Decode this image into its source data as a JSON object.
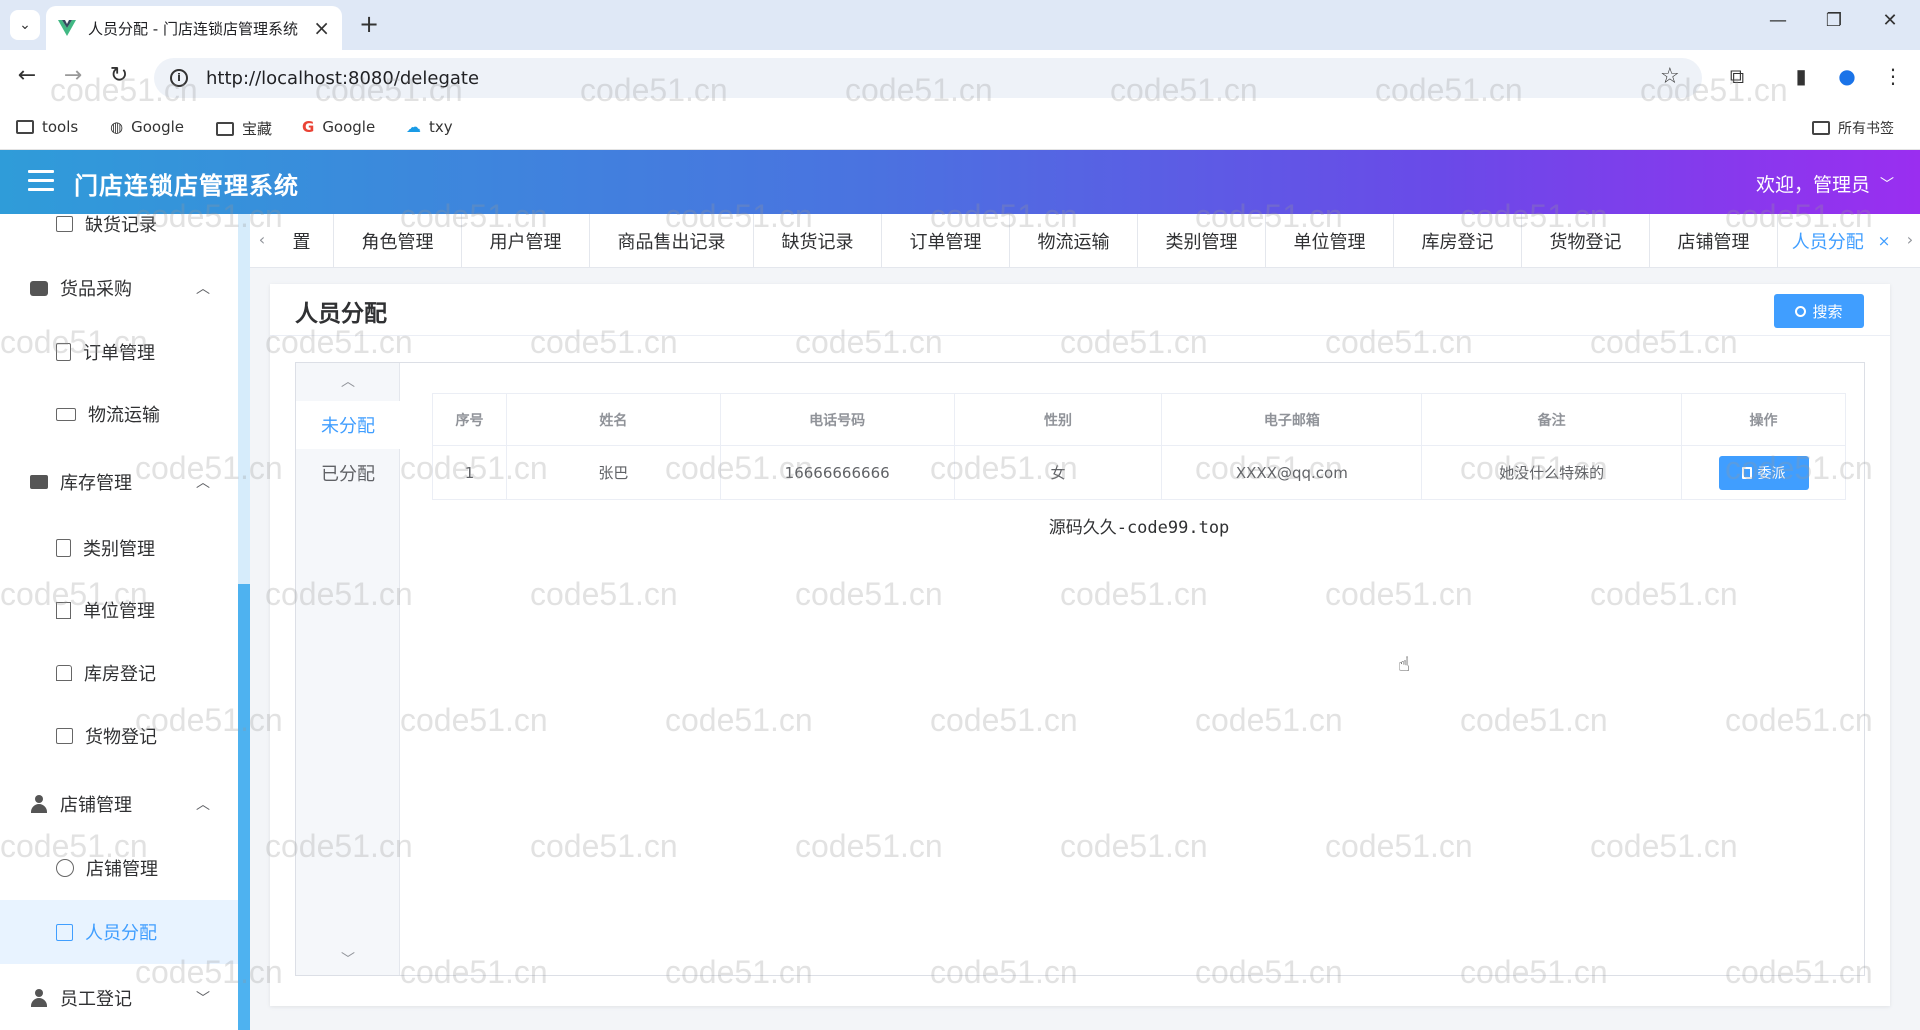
{
  "browser": {
    "tab_title": "人员分配 - 门店连锁店管理系统",
    "url": "http://localhost:8080/delegate",
    "bookmarks": [
      "tools",
      "Google",
      "宝藏",
      "Google",
      "txy"
    ],
    "all_bookmarks": "所有书签"
  },
  "header": {
    "title": "门店连锁店管理系统",
    "welcome": "欢迎，管理员"
  },
  "sidebar": {
    "items": [
      {
        "label": "缺货记录",
        "type": "sub",
        "icon": "stock-icon"
      },
      {
        "label": "货品采购",
        "type": "group",
        "icon": "bag-icon"
      },
      {
        "label": "订单管理",
        "type": "sub",
        "icon": "doc-icon"
      },
      {
        "label": "物流运输",
        "type": "sub",
        "icon": "truck-icon"
      },
      {
        "label": "库存管理",
        "type": "group",
        "icon": "stack-icon"
      },
      {
        "label": "类别管理",
        "type": "sub",
        "icon": "doc-icon"
      },
      {
        "label": "单位管理",
        "type": "sub",
        "icon": "building-icon"
      },
      {
        "label": "库房登记",
        "type": "sub",
        "icon": "home-icon"
      },
      {
        "label": "货物登记",
        "type": "sub",
        "icon": "box-icon"
      },
      {
        "label": "店铺管理",
        "type": "group",
        "icon": "user-icon"
      },
      {
        "label": "店铺管理",
        "type": "sub",
        "icon": "gear-icon"
      },
      {
        "label": "人员分配",
        "type": "sub",
        "icon": "edit-icon",
        "active": true
      },
      {
        "label": "员工登记",
        "type": "group",
        "icon": "user-icon"
      }
    ]
  },
  "tags": {
    "items": [
      "置",
      "角色管理",
      "用户管理",
      "商品售出记录",
      "缺货记录",
      "订单管理",
      "物流运输",
      "类别管理",
      "单位管理",
      "库房登记",
      "货物登记",
      "店铺管理",
      "人员分配"
    ],
    "active": "人员分配"
  },
  "page": {
    "title": "人员分配",
    "search_label": "搜索",
    "vtabs": [
      "未分配",
      "已分配"
    ],
    "table": {
      "headers": [
        "序号",
        "姓名",
        "电话号码",
        "性别",
        "电子邮箱",
        "备注",
        "操作"
      ],
      "rows": [
        {
          "index": "1",
          "name": "张巴",
          "phone": "16666666666",
          "gender": "女",
          "email": "XXXX@qq.com",
          "note": "她没什么特殊的",
          "action": "委派"
        }
      ]
    },
    "footer": "源码久久-code99.top"
  },
  "watermark": "code51.cn",
  "colors": {
    "primary": "#409eff",
    "header_start": "#2f9cd9",
    "header_end": "#9a2ef0"
  }
}
